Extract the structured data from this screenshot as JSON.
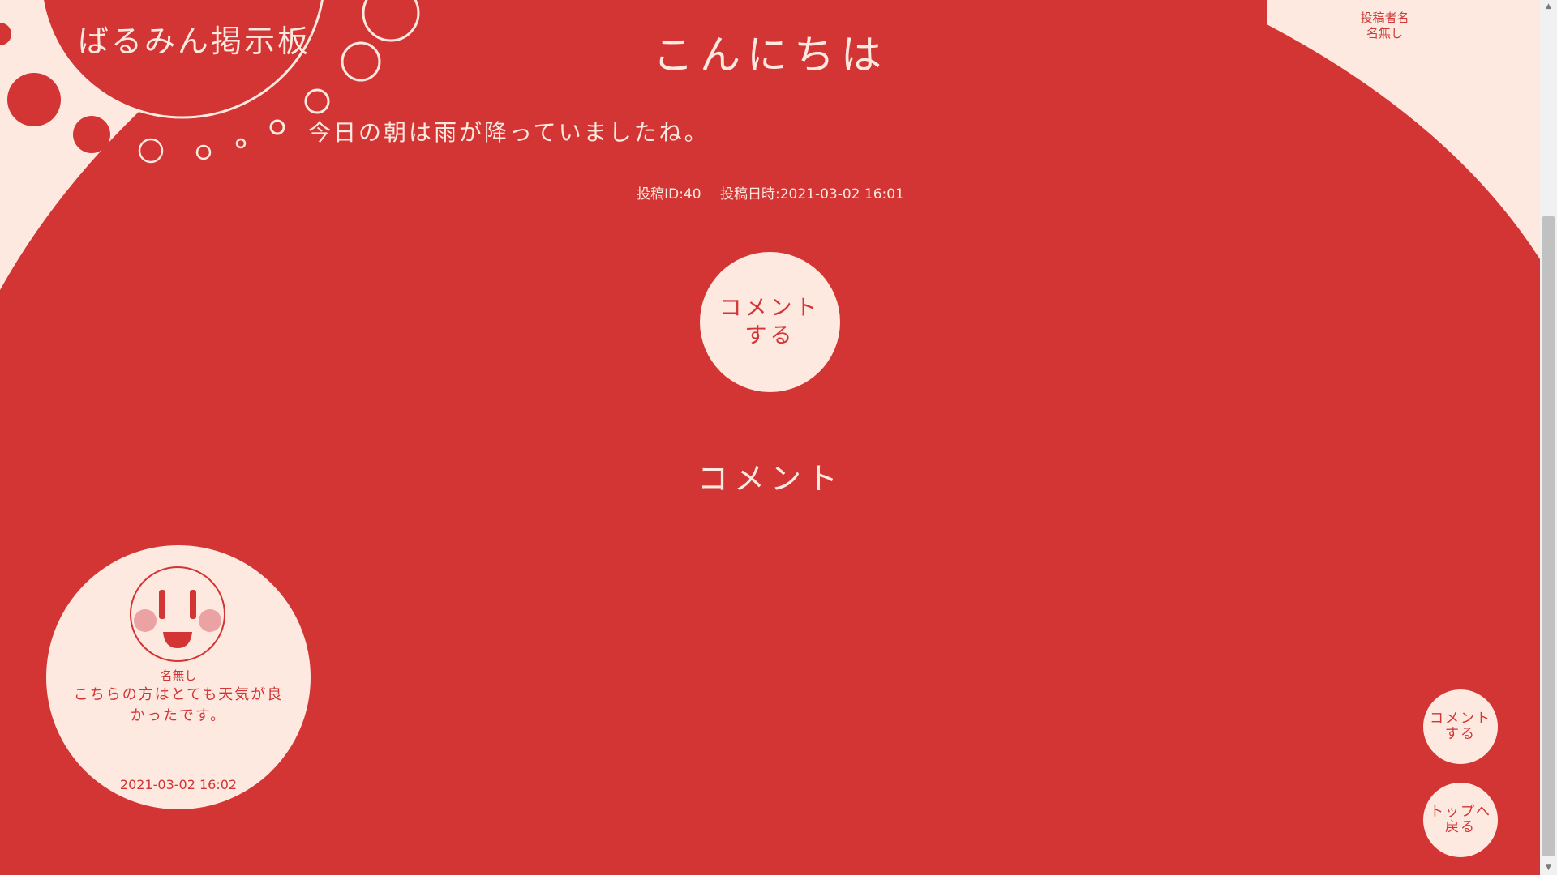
{
  "site": {
    "title": "ばるみん掲示板"
  },
  "post": {
    "title": "こんにちは",
    "body": "今日の朝は雨が降っていましたね。",
    "id_label": "投稿ID:40",
    "date_label": "投稿日時:2021-03-02 16:01"
  },
  "author_panel": {
    "label": "投稿者名",
    "name": "名無し"
  },
  "buttons": {
    "comment_main": "コメント\nする",
    "fab_comment": "コメント\nする",
    "fab_top": "トップへ\n戻る"
  },
  "comments_section": {
    "title": "コメント"
  },
  "comments": [
    {
      "author": "名無し",
      "text": "こちらの方はとても天気が良かったです。",
      "date": "2021-03-02 16:02"
    }
  ],
  "icons": {
    "avatar": "smiley-face-icon",
    "scroll_up": "triangle-up-icon",
    "scroll_down": "triangle-down-icon"
  },
  "colors": {
    "background": "#d33434",
    "cream": "#fde9df",
    "blush": "#eba2a2"
  }
}
